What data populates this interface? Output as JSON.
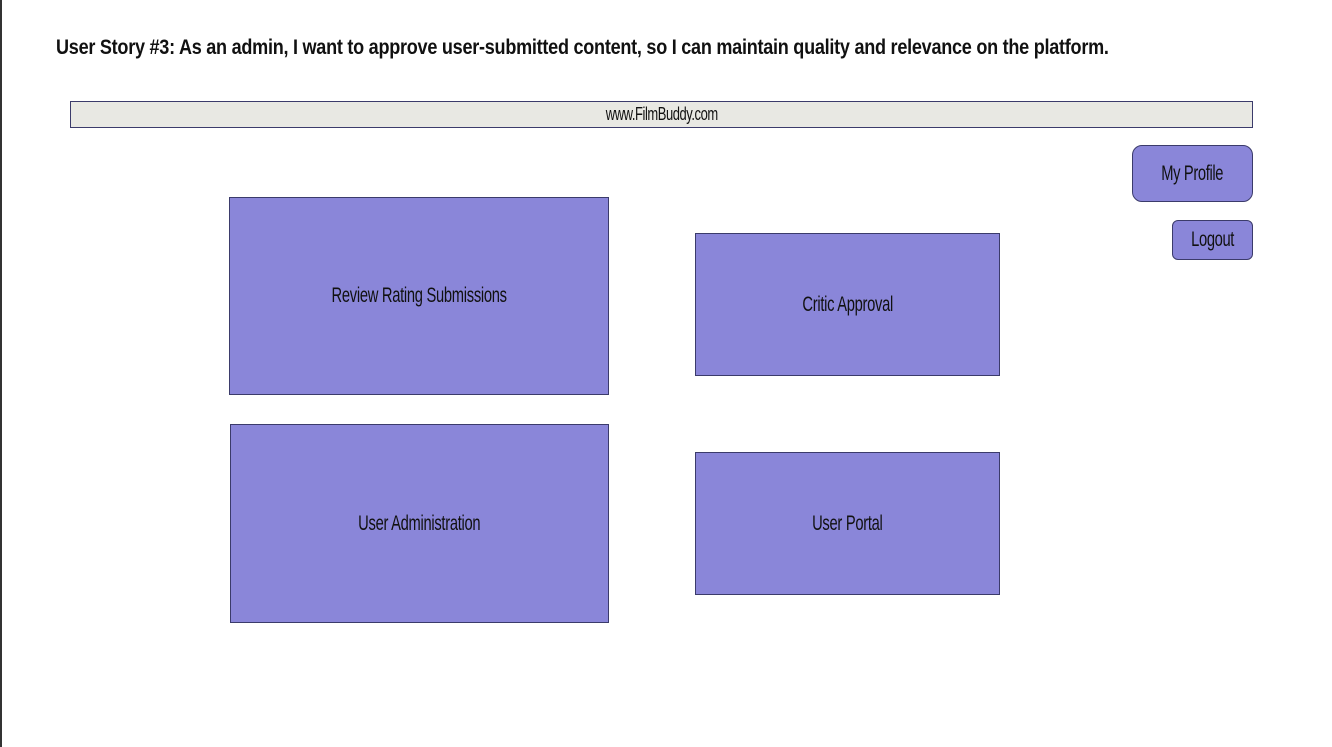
{
  "story": {
    "title": "User Story #3: As an admin, I want to approve user-submitted content, so I can maintain quality and relevance on the platform."
  },
  "browser": {
    "url": "www.FilmBuddy.com"
  },
  "account": {
    "profile_label": "My Profile",
    "logout_label": "Logout"
  },
  "dashboard": {
    "tiles": [
      {
        "label": "Review Rating Submissions"
      },
      {
        "label": "Critic Approval"
      },
      {
        "label": "User Administration"
      },
      {
        "label": "User Portal"
      }
    ]
  },
  "colors": {
    "tile_fill": "#8a86d9",
    "border": "#3b3b6b",
    "url_bar_fill": "#e8e8e3"
  }
}
